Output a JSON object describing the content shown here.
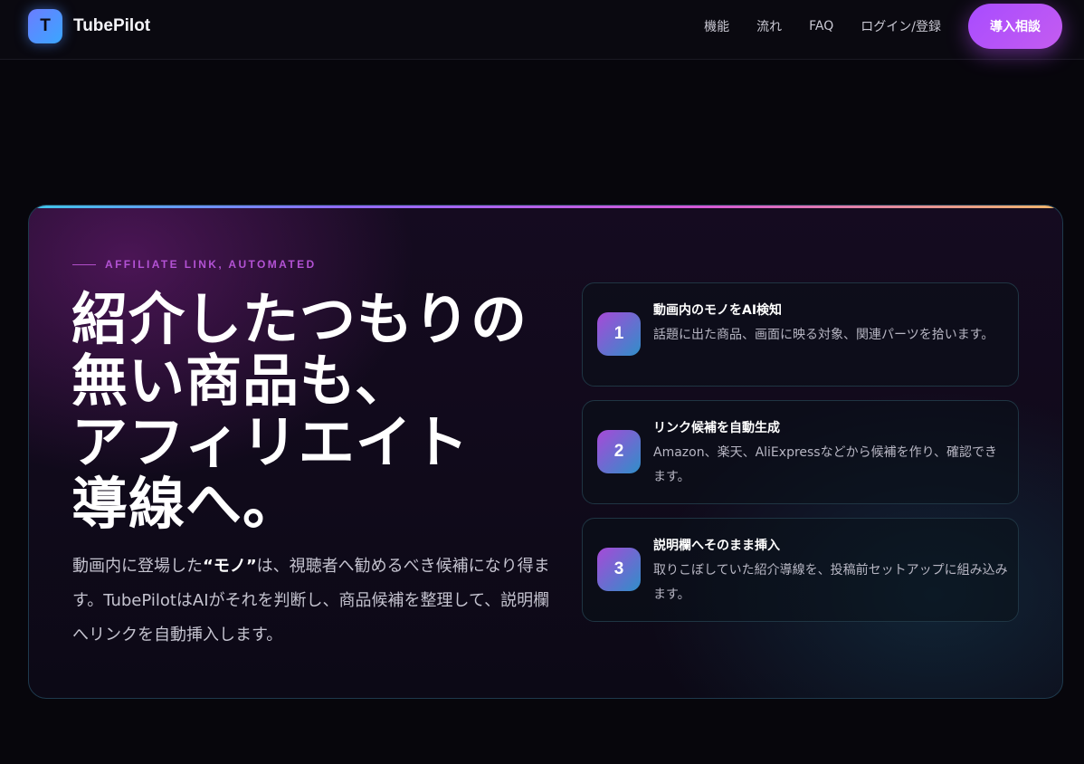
{
  "brand": {
    "logo_letter": "T",
    "name": "TubePilot"
  },
  "nav": {
    "items": [
      {
        "label": "機能"
      },
      {
        "label": "流れ"
      },
      {
        "label": "FAQ"
      },
      {
        "label": "ログイン/登録"
      }
    ],
    "cta_label": "導入相談"
  },
  "hero": {
    "eyebrow": "AFFILIATE LINK, AUTOMATED",
    "headline_lines": [
      "紹介したつもりの",
      "無い商品も、",
      "アフィリエイト",
      "導線へ。"
    ],
    "lead": {
      "before": "動画内に登場した",
      "emphasis": "“モノ”",
      "after": "は、視聴者へ勧めるべき候補になり得ます。TubePilotはAIがそれを判断し、商品候補を整理して、説明欄へリンクを自動挿入します。"
    },
    "steps": [
      {
        "number": "1",
        "title": "動画内のモノをAI検知",
        "description": "話題に出た商品、画面に映る対象、関連パーツを拾います。"
      },
      {
        "number": "2",
        "title": "リンク候補を自動生成",
        "description": "Amazon、楽天、AliExpressなどから候補を作り、確認できます。"
      },
      {
        "number": "3",
        "title": "説明欄へそのまま挿入",
        "description": "取りこぼしていた紹介導線を、投稿前セットアップに組み込みます。"
      }
    ]
  },
  "colors": {
    "background": "#07060c",
    "accent_purple": "#a84cff",
    "eyebrow": "#b352d4",
    "logo_blue": "#3aa6ff"
  }
}
